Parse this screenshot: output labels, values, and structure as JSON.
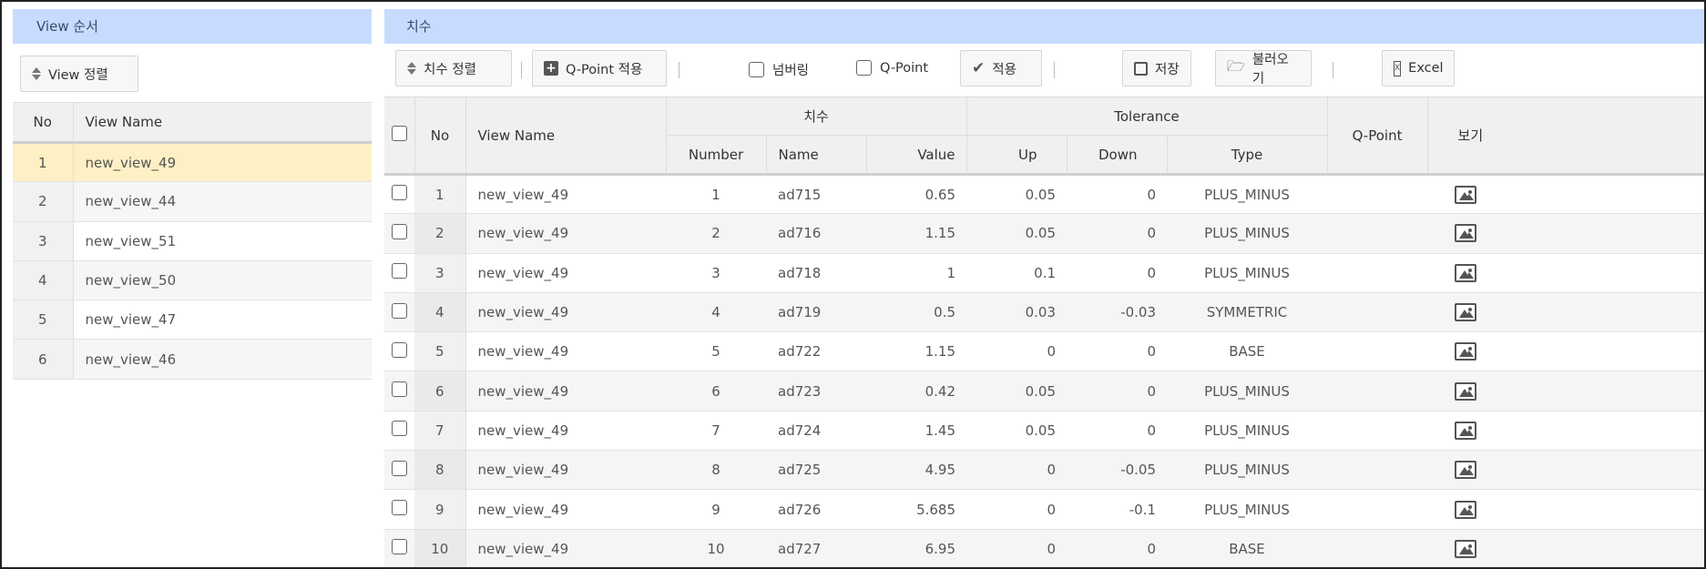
{
  "left_panel": {
    "title": "View 순서",
    "sort_button": "View 정렬",
    "columns": {
      "no": "No",
      "view_name": "View Name"
    },
    "rows": [
      {
        "no": "1",
        "name": "new_view_49"
      },
      {
        "no": "2",
        "name": "new_view_44"
      },
      {
        "no": "3",
        "name": "new_view_51"
      },
      {
        "no": "4",
        "name": "new_view_50"
      },
      {
        "no": "5",
        "name": "new_view_47"
      },
      {
        "no": "6",
        "name": "new_view_46"
      }
    ]
  },
  "right_panel": {
    "title": "치수",
    "toolbar": {
      "sort": "치수 정렬",
      "apply_qpoint": "Q-Point 적용",
      "numbering": "넘버링",
      "qpoint": "Q-Point",
      "apply": "적용",
      "save": "저장",
      "load": "불러오기",
      "excel": "Excel"
    },
    "columns": {
      "no": "No",
      "view_name": "View Name",
      "dimension_group": "치수",
      "number": "Number",
      "name": "Name",
      "value": "Value",
      "tolerance_group": "Tolerance",
      "up": "Up",
      "down": "Down",
      "type": "Type",
      "qpoint": "Q-Point",
      "view": "보기"
    },
    "rows": [
      {
        "no": "1",
        "view_name": "new_view_49",
        "number": "1",
        "name": "ad715",
        "value": "0.65",
        "up": "0.05",
        "down": "0",
        "type": "PLUS_MINUS",
        "qpoint": ""
      },
      {
        "no": "2",
        "view_name": "new_view_49",
        "number": "2",
        "name": "ad716",
        "value": "1.15",
        "up": "0.05",
        "down": "0",
        "type": "PLUS_MINUS",
        "qpoint": ""
      },
      {
        "no": "3",
        "view_name": "new_view_49",
        "number": "3",
        "name": "ad718",
        "value": "1",
        "up": "0.1",
        "down": "0",
        "type": "PLUS_MINUS",
        "qpoint": ""
      },
      {
        "no": "4",
        "view_name": "new_view_49",
        "number": "4",
        "name": "ad719",
        "value": "0.5",
        "up": "0.03",
        "down": "-0.03",
        "type": "SYMMETRIC",
        "qpoint": ""
      },
      {
        "no": "5",
        "view_name": "new_view_49",
        "number": "5",
        "name": "ad722",
        "value": "1.15",
        "up": "0",
        "down": "0",
        "type": "BASE",
        "qpoint": ""
      },
      {
        "no": "6",
        "view_name": "new_view_49",
        "number": "6",
        "name": "ad723",
        "value": "0.42",
        "up": "0.05",
        "down": "0",
        "type": "PLUS_MINUS",
        "qpoint": ""
      },
      {
        "no": "7",
        "view_name": "new_view_49",
        "number": "7",
        "name": "ad724",
        "value": "1.45",
        "up": "0.05",
        "down": "0",
        "type": "PLUS_MINUS",
        "qpoint": ""
      },
      {
        "no": "8",
        "view_name": "new_view_49",
        "number": "8",
        "name": "ad725",
        "value": "4.95",
        "up": "0",
        "down": "-0.05",
        "type": "PLUS_MINUS",
        "qpoint": ""
      },
      {
        "no": "9",
        "view_name": "new_view_49",
        "number": "9",
        "name": "ad726",
        "value": "5.685",
        "up": "0",
        "down": "-0.1",
        "type": "PLUS_MINUS",
        "qpoint": ""
      },
      {
        "no": "10",
        "view_name": "new_view_49",
        "number": "10",
        "name": "ad727",
        "value": "6.95",
        "up": "0",
        "down": "0",
        "type": "BASE",
        "qpoint": ""
      }
    ]
  },
  "colors": {
    "header_bg": "#c7dbff",
    "selected_row": "#fdf0c4"
  },
  "icons": {
    "sort": "sort-updown-icon",
    "plus": "plus-square-icon",
    "check": "checkmark-icon",
    "save": "floppy-disk-icon",
    "load": "folder-open-icon",
    "excel": "excel-file-icon",
    "view": "image-icon"
  }
}
